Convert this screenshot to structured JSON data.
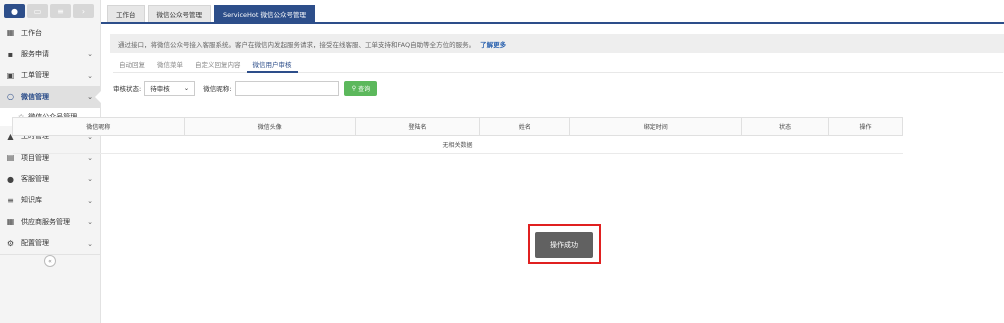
{
  "sidebar": {
    "top_buttons": [
      "person-icon",
      "monitor-icon",
      "list-icon",
      "chevron-icon"
    ],
    "items": [
      {
        "label": "工作台",
        "icon": "windows-icon",
        "chevron": false
      },
      {
        "label": "服务申请",
        "icon": "book-icon",
        "chevron": true
      },
      {
        "label": "工单管理",
        "icon": "rss-icon",
        "chevron": true
      },
      {
        "label": "微信管理",
        "icon": "chat-icon",
        "chevron": true,
        "active": true
      },
      {
        "label": "工时管理",
        "icon": "road-icon",
        "chevron": true
      },
      {
        "label": "项目管理",
        "icon": "table-icon",
        "chevron": true
      },
      {
        "label": "客服管理",
        "icon": "user-icon",
        "chevron": true
      },
      {
        "label": "知识库",
        "icon": "list-icon",
        "chevron": true
      },
      {
        "label": "供应商服务管理",
        "icon": "grid-icon",
        "chevron": true
      },
      {
        "label": "配置管理",
        "icon": "gear-icon",
        "chevron": true
      }
    ],
    "sub_item": "微信公众号管理"
  },
  "tabs": [
    "工作台",
    "微信公众号管理",
    "ServiceHot 微信公众号管理"
  ],
  "notice": {
    "text": "通过接口，将微信公众号接入客服系统。客户在微信内发起服务请求，接受在线客服、工单支持和FAQ自助等全方位的服务。",
    "link": "了解更多"
  },
  "subtabs": [
    "自动回复",
    "微信菜单",
    "自定义回复内容",
    "微信用户审核"
  ],
  "filters": {
    "status_label": "审核状态:",
    "status_value": "待审核",
    "nickname_label": "微信昵称:",
    "query_button": "查询"
  },
  "table": {
    "headers": [
      "微信昵称",
      "微信头像",
      "登陆名",
      "姓名",
      "绑定时间",
      "状态",
      "操作"
    ],
    "empty_text": "无相关数据"
  },
  "toast": "操作成功"
}
